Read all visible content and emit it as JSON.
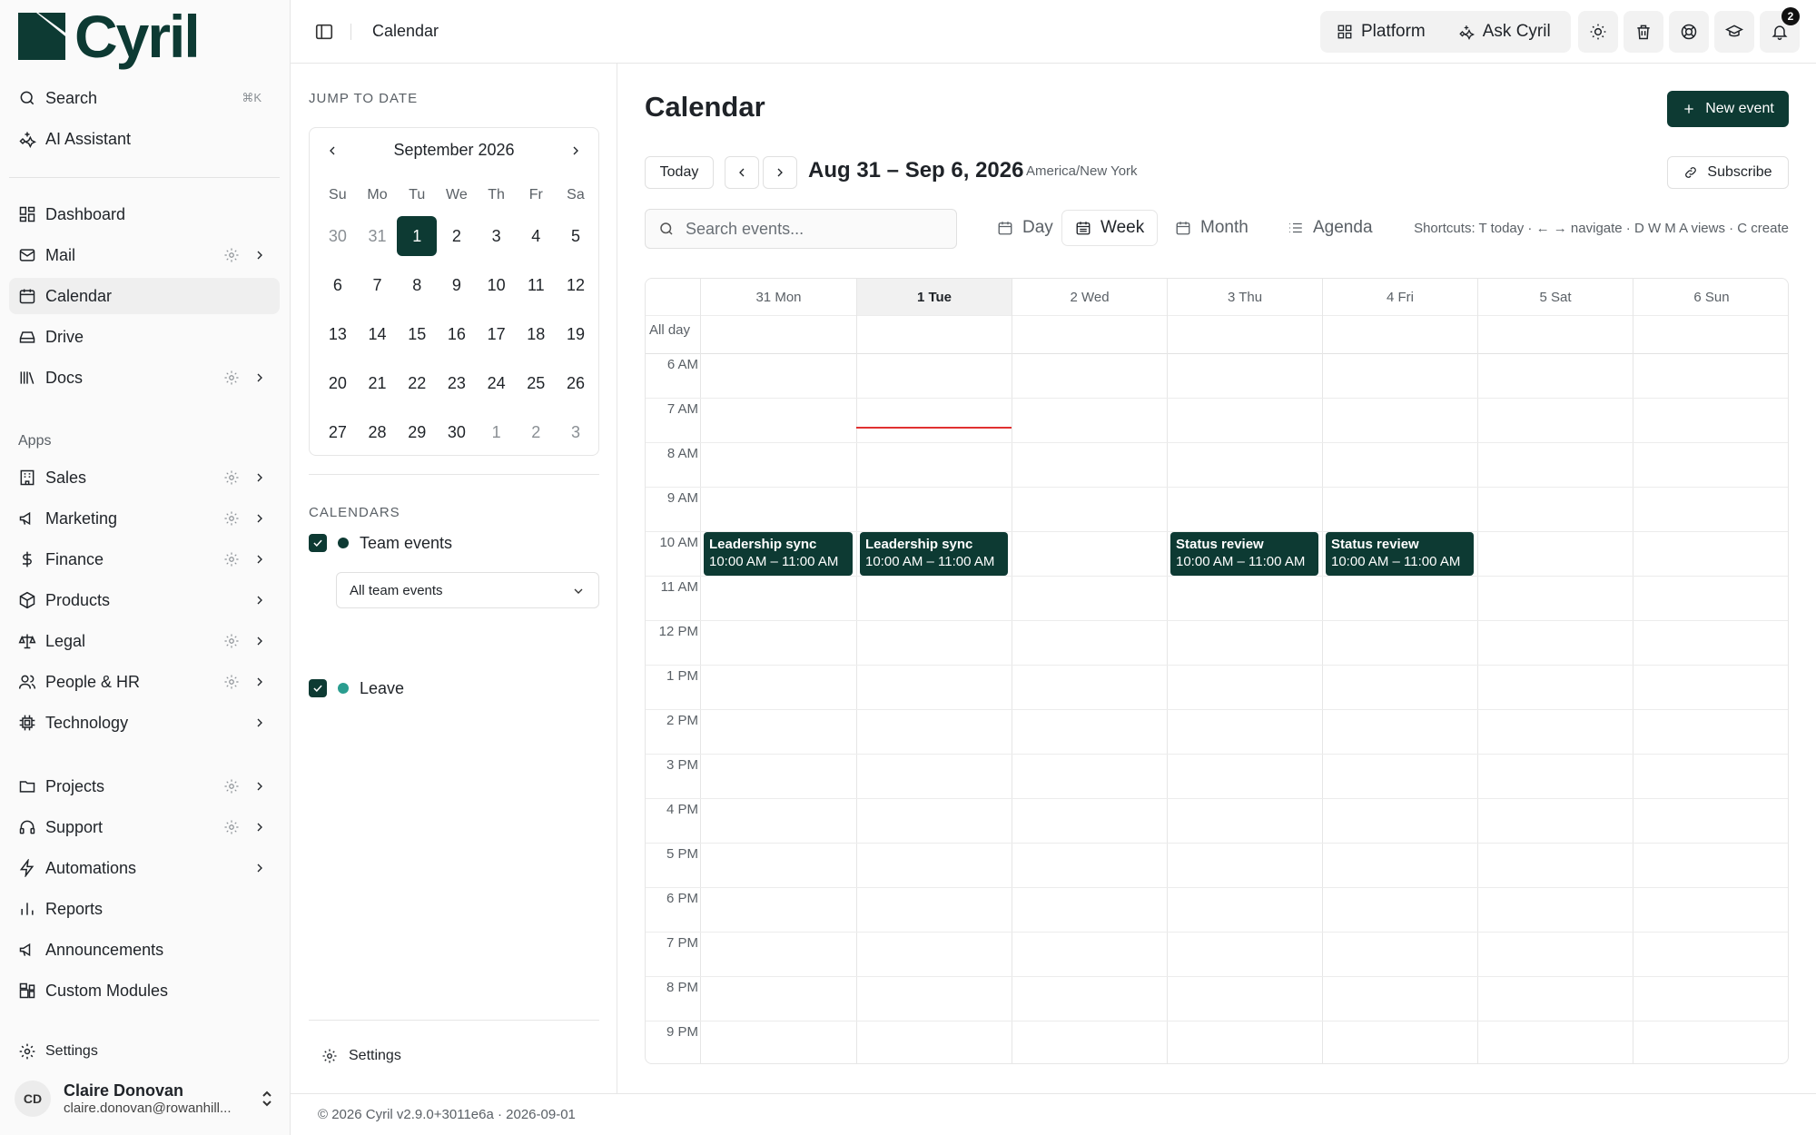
{
  "brand": {
    "name": "Cyril"
  },
  "sidebar": {
    "search_label": "Search",
    "search_shortcut": "⌘K",
    "ai_label": "AI Assistant",
    "main_items": [
      {
        "label": "Dashboard",
        "icon": "dashboard-icon"
      },
      {
        "label": "Mail",
        "icon": "mail-icon"
      },
      {
        "label": "Calendar",
        "icon": "calendar-icon"
      },
      {
        "label": "Drive",
        "icon": "drive-icon"
      },
      {
        "label": "Docs",
        "icon": "docs-icon"
      }
    ],
    "apps_label": "Apps",
    "apps": [
      {
        "label": "Sales",
        "icon": "sales-icon"
      },
      {
        "label": "Marketing",
        "icon": "megaphone-icon"
      },
      {
        "label": "Finance",
        "icon": "dollar-icon"
      },
      {
        "label": "Products",
        "icon": "box-icon"
      },
      {
        "label": "Legal",
        "icon": "scale-icon"
      },
      {
        "label": "People & HR",
        "icon": "people-icon"
      },
      {
        "label": "Technology",
        "icon": "chip-icon"
      }
    ],
    "more": [
      {
        "label": "Projects",
        "icon": "folder-icon"
      },
      {
        "label": "Support",
        "icon": "headset-icon"
      },
      {
        "label": "Automations",
        "icon": "bolt-icon"
      },
      {
        "label": "Reports",
        "icon": "bar-chart-icon"
      },
      {
        "label": "Announcements",
        "icon": "megaphone-icon"
      },
      {
        "label": "Custom Modules",
        "icon": "modules-icon"
      }
    ],
    "settings_label": "Settings",
    "user": {
      "initials": "CD",
      "name": "Claire Donovan",
      "email": "claire.donovan@rowanhill..."
    }
  },
  "topbar": {
    "title": "Calendar",
    "platform_label": "Platform",
    "ask_label": "Ask Cyril",
    "notification_count": "2"
  },
  "jump": {
    "label": "JUMP TO DATE",
    "month_label": "September 2026",
    "weekdays": [
      "Su",
      "Mo",
      "Tu",
      "We",
      "Th",
      "Fr",
      "Sa"
    ],
    "weeks": [
      [
        "30",
        "31",
        "1",
        "2",
        "3",
        "4",
        "5"
      ],
      [
        "6",
        "7",
        "8",
        "9",
        "10",
        "11",
        "12"
      ],
      [
        "13",
        "14",
        "15",
        "16",
        "17",
        "18",
        "19"
      ],
      [
        "20",
        "21",
        "22",
        "23",
        "24",
        "25",
        "26"
      ],
      [
        "27",
        "28",
        "29",
        "30",
        "1",
        "2",
        "3"
      ]
    ]
  },
  "calendars": {
    "label": "CALENDARS",
    "team_label": "Team events",
    "team_color": "#0d3a33",
    "filter_value": "All team events",
    "leave_label": "Leave",
    "leave_color": "#2a9d8f",
    "settings_label": "Settings"
  },
  "main": {
    "title": "Calendar",
    "new_event_label": "New event",
    "today_label": "Today",
    "range_label": "Aug 31 – Sep 6, 2026",
    "timezone": "America/New York",
    "subscribe_label": "Subscribe",
    "search_placeholder": "Search events...",
    "views": {
      "day": "Day",
      "week": "Week",
      "month": "Month",
      "agenda": "Agenda"
    },
    "shortcuts": "Shortcuts: T today · ← → navigate · D W M A views · C create",
    "allday_label": "All day",
    "days": [
      "31 Mon",
      "1 Tue",
      "2 Wed",
      "3 Thu",
      "4 Fri",
      "5 Sat",
      "6 Sun"
    ],
    "hours": [
      "6 AM",
      "7 AM",
      "8 AM",
      "9 AM",
      "10 AM",
      "11 AM",
      "12 PM",
      "1 PM",
      "2 PM",
      "3 PM",
      "4 PM",
      "5 PM",
      "6 PM",
      "7 PM",
      "8 PM",
      "9 PM"
    ],
    "events": [
      {
        "title": "Leadership sync",
        "time": "10:00 AM – 11:00 AM"
      },
      {
        "title": "Leadership sync",
        "time": "10:00 AM – 11:00 AM"
      },
      {
        "title": "Status review",
        "time": "10:00 AM – 11:00 AM"
      },
      {
        "title": "Status review",
        "time": "10:00 AM – 11:00 AM"
      }
    ]
  },
  "footer": {
    "text": "© 2026 Cyril v2.9.0+3011e6a · 2026-09-01"
  },
  "colors": {
    "brand": "#0d3a33",
    "now_line": "#e03131"
  }
}
